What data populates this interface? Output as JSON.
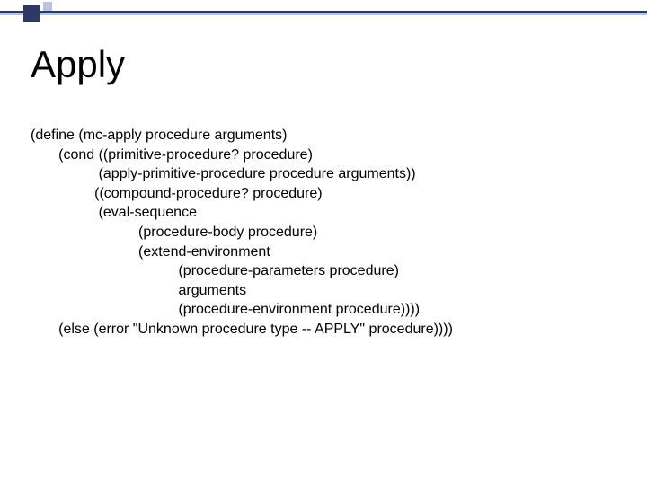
{
  "title": "Apply",
  "code": {
    "l1": "(define (mc-apply procedure arguments)",
    "l2": "       (cond ((primitive-procedure? procedure)",
    "l3": "                 (apply-primitive-procedure procedure arguments))",
    "l4": "                ((compound-procedure? procedure)",
    "l5": "                 (eval-sequence",
    "l6": "                           (procedure-body procedure)",
    "l7": "                           (extend-environment",
    "l8": "                                     (procedure-parameters procedure)",
    "l9": "                                     arguments",
    "l10": "                                     (procedure-environment procedure))))",
    "l11": "       (else (error \"Unknown procedure type -- APPLY\" procedure))))"
  }
}
